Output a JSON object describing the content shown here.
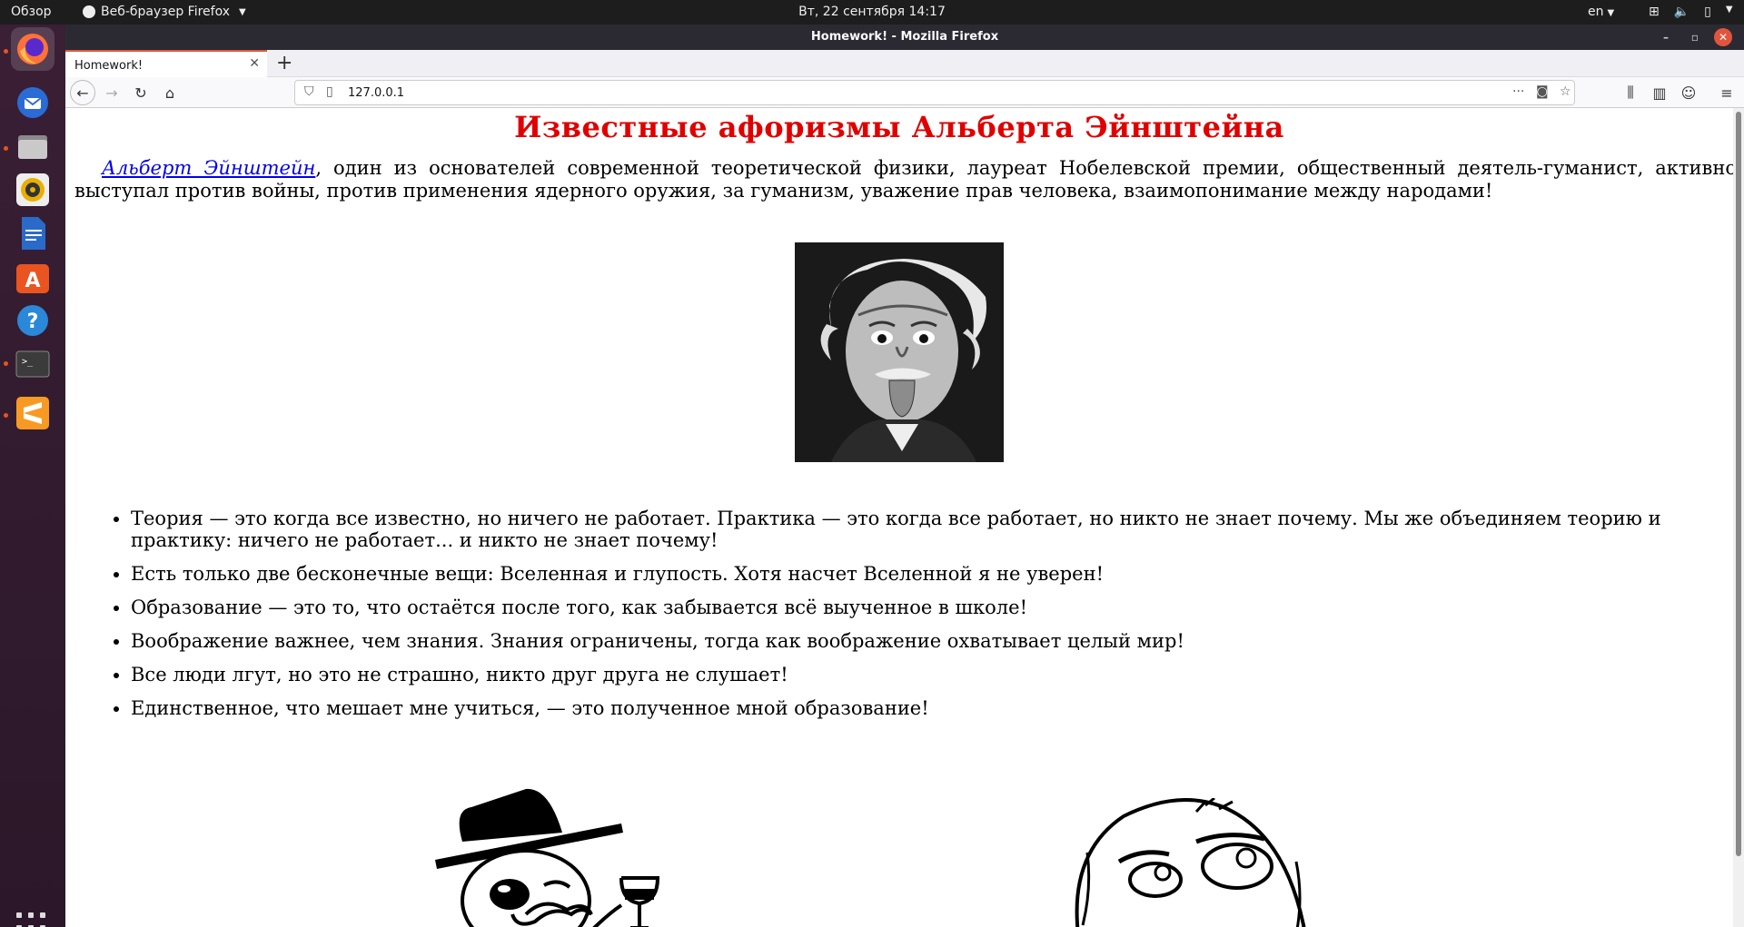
{
  "topbar": {
    "activities": "Обзор",
    "app_menu": "Веб-браузер Firefox",
    "clock": "Вт, 22 сентября  14:17",
    "lang": "en"
  },
  "dock": {
    "items": [
      "firefox-icon",
      "thunderbird-icon",
      "files-icon",
      "rhythmbox-icon",
      "writer-icon",
      "software-icon",
      "help-icon",
      "terminal-icon",
      "sublime-icon"
    ]
  },
  "window": {
    "title": "Homework! - Mozilla Firefox"
  },
  "tab": {
    "label": "Homework!"
  },
  "urlbar": {
    "url": "127.0.0.1"
  },
  "page": {
    "title": "Известные афоризмы Альберта Эйнштейна",
    "intro_link": "Альберт Эйнштейн",
    "intro_text": ", один из основателей современной теоретической физики, лауреат Нобелевской премии, общественный деятель-гуманист, активно выступал против войны, против применения ядерного оружия, за гуманизм, уважение прав человека, взаимопонимание между народами!",
    "quotes": [
      "Теория — это когда все известно, но ничего не работает. Практика — это когда все работает, но никто не знает почему. Мы же объединяем теорию и практику: ничего не работает... и никто не знает почему!",
      "Есть только две бесконечные вещи: Вселенная и глупость. Хотя насчет Вселенной я не уверен!",
      "Образование — это то, что остаётся после того, как забывается всё выученное в школе!",
      "Воображение важнее, чем знания. Знания ограничены, тогда как воображение охватывает целый мир!",
      "Все люди лгут, но это не страшно, никто друг друга не слушает!",
      "Единственное, что мешает мне учиться, — это полученное мной образование!"
    ]
  },
  "colors": {
    "title_red": "#e00000",
    "link_blue": "#0000ee",
    "accent": "#e2553c"
  }
}
